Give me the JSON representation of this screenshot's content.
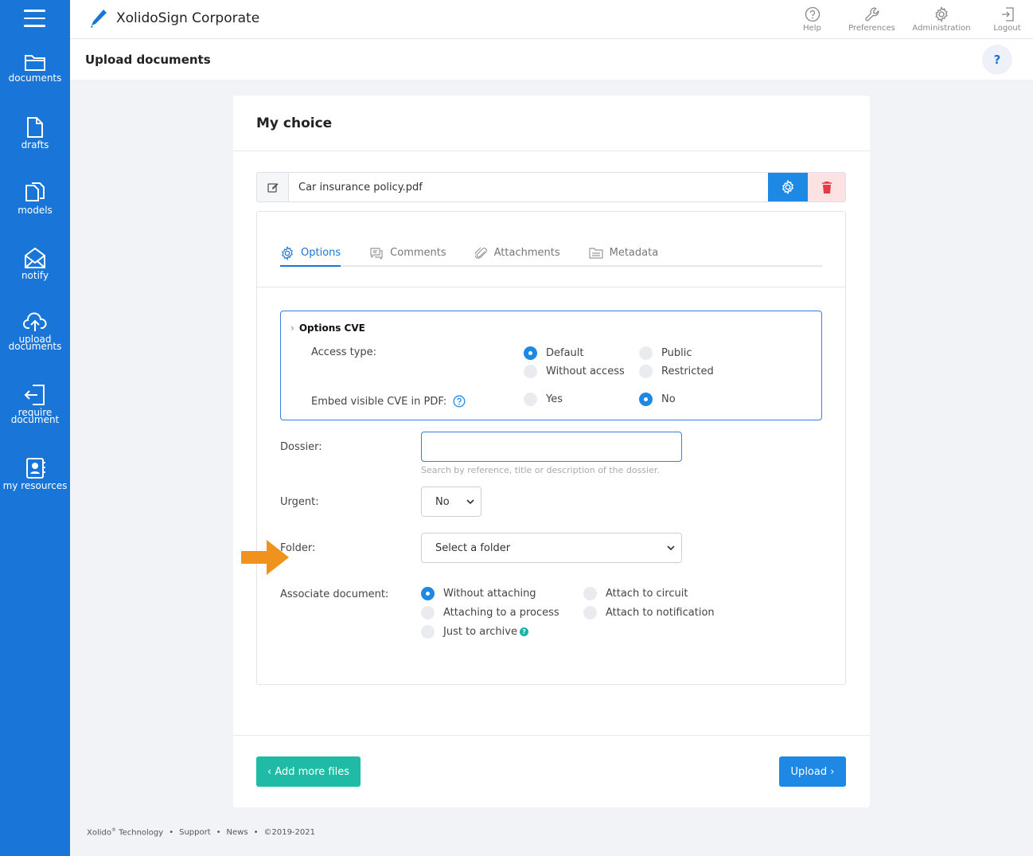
{
  "app": {
    "title": "XolidoSign Corporate"
  },
  "sidebar": {
    "items": [
      {
        "label": "documents",
        "icon": "folder-icon"
      },
      {
        "label": "drafts",
        "icon": "file-icon"
      },
      {
        "label": "models",
        "icon": "copy-icon"
      },
      {
        "label": "notify",
        "icon": "envelope-icon"
      },
      {
        "label_line1": "upload",
        "label_line2": "documents",
        "icon": "cloud-upload-icon"
      },
      {
        "label_line1": "require",
        "label_line2": "document",
        "icon": "sign-in-icon"
      },
      {
        "label": "my resources",
        "icon": "contact-book-icon"
      }
    ]
  },
  "topbar": {
    "actions": [
      {
        "label": "Help",
        "icon": "question-circle-icon"
      },
      {
        "label": "Preferences",
        "icon": "wrench-icon"
      },
      {
        "label": "Administration",
        "icon": "gear-icon"
      },
      {
        "label": "Logout",
        "icon": "logout-icon"
      }
    ]
  },
  "header": {
    "title": "Upload documents",
    "help": "?"
  },
  "card": {
    "title": "My choice",
    "file_name": "Car insurance policy.pdf",
    "tabs": [
      {
        "label": "Options",
        "active": true
      },
      {
        "label": "Comments"
      },
      {
        "label": "Attachments"
      },
      {
        "label": "Metadata"
      }
    ],
    "cve": {
      "title": "Options CVE",
      "access_label": "Access type:",
      "access_options": [
        "Default",
        "Public",
        "Without access",
        "Restricted"
      ],
      "access_selected": "Default",
      "embed_label": "Embed visible CVE in PDF:",
      "embed_options": [
        "Yes",
        "No"
      ],
      "embed_selected": "No"
    },
    "dossier": {
      "label": "Dossier:",
      "value": "",
      "hint": "Search by reference, title or description of the dossier."
    },
    "urgent": {
      "label": "Urgent:",
      "value": "No"
    },
    "folder": {
      "label": "Folder:",
      "value": "Select a folder"
    },
    "associate": {
      "label": "Associate document:",
      "options": [
        "Without attaching",
        "Attach to circuit",
        "Attaching to a process",
        "Attach to notification",
        "Just to archive"
      ],
      "selected": "Without attaching"
    },
    "add_more": "‹ Add more files",
    "upload": "Upload ›"
  },
  "footer": {
    "company": "Xolido",
    "reg": "®",
    "company_suffix": " Technology",
    "support": "Support",
    "news": "News",
    "copyright": "©2019-2021",
    "bullet": "•"
  },
  "colors": {
    "sidebar": "#1976d8",
    "primary": "#1e88e5",
    "teal": "#1fbba6",
    "arrow": "#f0931e"
  }
}
